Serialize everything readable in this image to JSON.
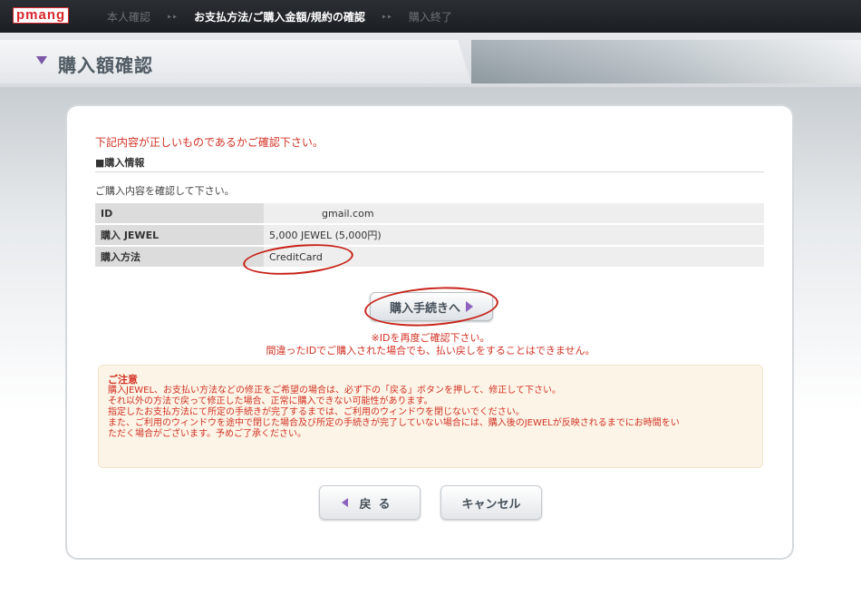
{
  "topbar": {
    "logo": "pmang",
    "steps": [
      {
        "label": "本人確認",
        "active": false
      },
      {
        "label": "お支払方法/ご購入金額/規約の確認",
        "active": true
      },
      {
        "label": "購入終了",
        "active": false
      }
    ],
    "separator": "▸▸"
  },
  "header": {
    "title": "購入額確認"
  },
  "content": {
    "warning_top": "下記内容が正しいものであるかご確認下さい。",
    "section_title": "■購入情報",
    "confirm_note": "ご購入内容を確認して下さい。",
    "table": [
      {
        "key": "ID",
        "value": "gmail.com"
      },
      {
        "key": "購入 JEWEL",
        "value": "5,000 JEWEL (5,000円)"
      },
      {
        "key": "購入方法",
        "value": "CreditCard"
      }
    ]
  },
  "purchase_button": {
    "label": "購入手続きへ"
  },
  "id_warning": {
    "line1": "※IDを再度ご確認下さい。",
    "line2": "間違ったIDでご購入された場合でも、払い戻しをすることはできません。"
  },
  "notice": {
    "title": "ご注意",
    "lines": [
      "購入JEWEL、お支払い方法などの修正をご希望の場合は、必ず下の「戻る」ボタンを押して、修正して下さい。",
      "それ以外の方法で戻って修正した場合、正常に購入できない可能性があります。",
      "指定したお支払方法にて所定の手続きが完了するまでは、ご利用のウィンドウを閉じないでください。",
      "また、ご利用のウィンドウを途中で閉じた場合及び所定の手続きが完了していない場合には、購入後のJEWELが反映されるまでにお時間をい",
      "ただく場合がございます。予めご了承ください。"
    ]
  },
  "buttons": {
    "back": "戻る",
    "cancel": "キャンセル"
  },
  "colors": {
    "accent_red": "#d23225",
    "accent_purple": "#8d63be",
    "topbar_bg": "#1b1e22"
  }
}
